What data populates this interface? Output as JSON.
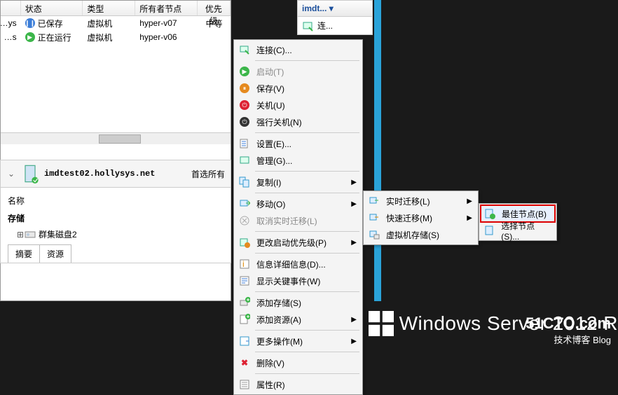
{
  "table": {
    "headers": {
      "status": "状态",
      "type": "类型",
      "owner": "所有者节点",
      "priority": "优先级"
    },
    "rows": [
      {
        "name_suffix": "ys…",
        "icon": "pause",
        "status": "已保存",
        "type": "虚拟机",
        "owner": "hyper-v07",
        "priority": "中等"
      },
      {
        "name_suffix": "s…",
        "icon": "play",
        "status": "正在运行",
        "type": "虚拟机",
        "owner": "hyper-v06",
        "priority": ""
      }
    ]
  },
  "detail": {
    "host": "imdtest02.hollysys.net",
    "pref_label": "首选所有",
    "name_label": "名称",
    "storage_label": "存储",
    "disk": "群集磁盘2",
    "tabs": {
      "summary": "摘要",
      "resource": "资源"
    }
  },
  "actions": {
    "header": "imdt...",
    "dropdown": "▾",
    "connect": "连..."
  },
  "menu": {
    "connect": "连接(C)...",
    "start": "启动(T)",
    "save": "保存(V)",
    "shutdown": "关机(U)",
    "poweroff": "强行关机(N)",
    "settings": "设置(E)...",
    "manage": "管理(G)...",
    "replicate": "复制(I)",
    "move": "移动(O)",
    "cancel_live": "取消实时迁移(L)",
    "change_prio": "更改启动优先级(P)",
    "info": "信息详细信息(D)...",
    "critical": "显示关键事件(W)",
    "add_storage": "添加存储(S)",
    "add_resource": "添加资源(A)",
    "more": "更多操作(M)",
    "delete": "删除(V)",
    "properties": "属性(R)"
  },
  "submenu1": {
    "live": "实时迁移(L)",
    "quick": "快速迁移(M)",
    "vm_storage": "虚拟机存储(S)"
  },
  "submenu2": {
    "best": "最佳节点(B)",
    "select": "选择节点(S)..."
  },
  "branding": {
    "windows": "Windows Server 2012 R",
    "blog_main": "51CTO.com",
    "blog_sub": "技术博客  Blog"
  }
}
